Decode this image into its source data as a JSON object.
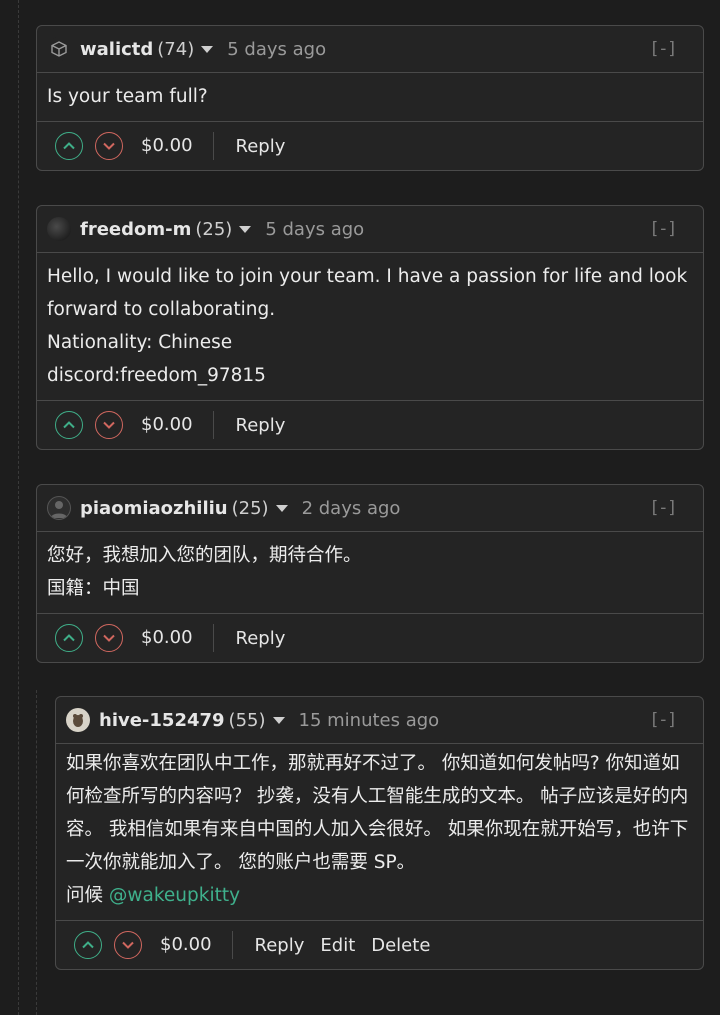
{
  "comments": [
    {
      "author": "walictd",
      "rep": "(74)",
      "time": "5 days ago",
      "collapse": "[-]",
      "body": [
        "Is your team full?"
      ],
      "payout": "$0.00",
      "actions": [
        "Reply"
      ]
    },
    {
      "author": "freedom-m",
      "rep": "(25)",
      "time": "5 days ago",
      "collapse": "[-]",
      "body": [
        "Hello, I would like to join your team. I have a passion for life and look forward to collaborating.",
        "Nationality: Chinese",
        "discord:freedom_97815"
      ],
      "payout": "$0.00",
      "actions": [
        "Reply"
      ]
    },
    {
      "author": "piaomiaozhiliu",
      "rep": "(25)",
      "time": "2 days ago",
      "collapse": "[-]",
      "body": [
        "您好，我想加入您的团队，期待合作。",
        "国籍：中国"
      ],
      "payout": "$0.00",
      "actions": [
        "Reply"
      ]
    },
    {
      "author": "hive-152479",
      "rep": "(55)",
      "time": "15 minutes ago",
      "collapse": "[-]",
      "body": [
        "如果你喜欢在团队中工作，那就再好不过了。 你知道如何发帖吗? 你知道如何检查所写的内容吗？ 抄袭，没有人工智能生成的文本。 帖子应该是好的内容。 我相信如果有来自中国的人加入会很好。 如果你现在就开始写，也许下一次你就能加入了。 您的账户也需要 SP。"
      ],
      "greeting": "问候",
      "mention": "@wakeupkitty",
      "payout": "$0.00",
      "actions": [
        "Reply",
        "Edit",
        "Delete"
      ]
    }
  ],
  "colors": {
    "upvote": "#3fae88",
    "downvote": "#d0675f",
    "mention": "#3fb08c"
  }
}
